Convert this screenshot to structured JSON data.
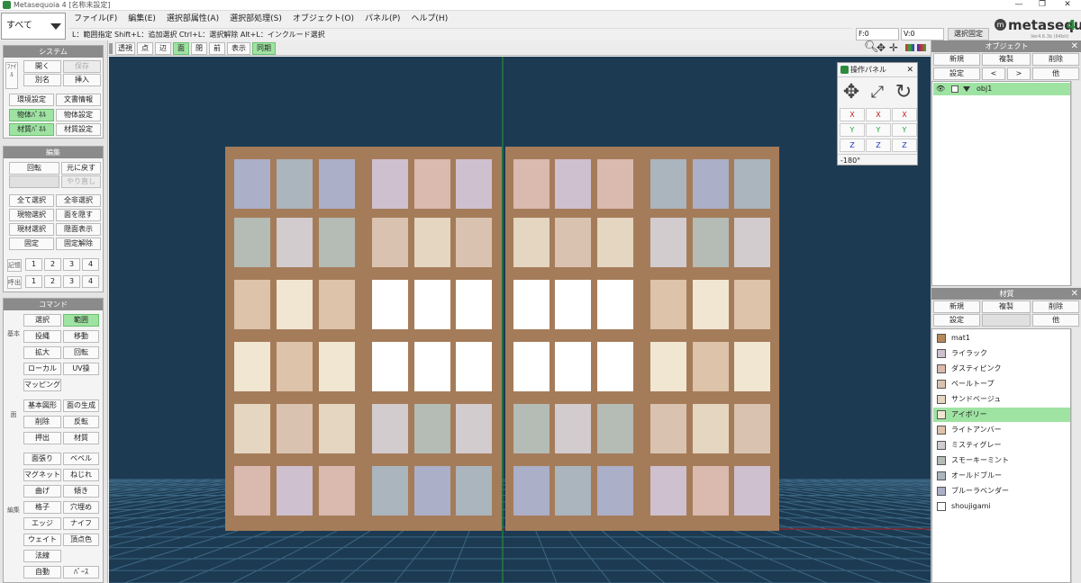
{
  "window": {
    "title": "Metasequoia 4 [名称未設定]",
    "controls": [
      "—",
      "❐",
      "✕"
    ]
  },
  "object_dropdown": {
    "value": "すべて"
  },
  "menu": [
    "ファイル(F)",
    "編集(E)",
    "選択部属性(A)",
    "選択部処理(S)",
    "オブジェクト(O)",
    "パネル(P)",
    "ヘルプ(H)"
  ],
  "hint": "L：範囲指定  Shift+L：追加選択  Ctrl+L：選択解除  Alt+L：インクルード選択",
  "status": {
    "f": "F:0",
    "v": "V:0",
    "lock": "選択固定"
  },
  "logo": {
    "text": "metasequoia",
    "num": "4",
    "version": "Ver4.6.3b (64bit)"
  },
  "system": {
    "title": "システム",
    "file_label": "ﾌｧｲﾙ",
    "open": "開く",
    "save": "保存",
    "save_as": "別名",
    "insert": "挿入",
    "env": "環境設定",
    "docinfo": "文書情報",
    "objpanel": "物体ﾊﾟﾈﾙ",
    "objset": "物体設定",
    "matpanel": "材質ﾊﾟﾈﾙ",
    "matset": "材質設定"
  },
  "edit": {
    "title": "編集",
    "rotate": "回転",
    "undo": "元に戻す",
    "redo": "やり直し",
    "selall": "全て選択",
    "deselall": "全非選択",
    "selobj": "現物選択",
    "hideface": "面を隠す",
    "selmat": "現材選択",
    "showhidden": "隠面表示",
    "fix": "固定",
    "unfix": "固定解除",
    "memory_label": "記憶",
    "recall_label": "呼出",
    "slots": [
      "1",
      "2",
      "3",
      "4"
    ]
  },
  "command": {
    "title": "コマンド",
    "group1_label": "基本",
    "group2_label": "面",
    "group3_label": "編集",
    "select": "選択",
    "range": "範囲",
    "lasso": "投縄",
    "move": "移動",
    "scale": "拡大",
    "rotate": "回転",
    "local": "ローカル",
    "uv": "UV操",
    "mapping": "マッピング",
    "primitive": "基本図形",
    "genface": "面の生成",
    "delete": "削除",
    "flip": "反転",
    "extrude": "押出",
    "material": "材質",
    "faceextend": "面張り",
    "bevel": "ベベル",
    "magnet": "マグネット",
    "twist": "ねじれ",
    "bend": "曲げ",
    "tilt": "傾き",
    "lattice": "格子",
    "hole": "穴埋め",
    "edge": "エッジ",
    "knife": "ナイフ",
    "weld": "ウェイト",
    "vcolor": "頂点色",
    "normal": "法線",
    "more1": "自動",
    "more2": "ﾊﾟｰｽ"
  },
  "view_toolbar": {
    "buttons": [
      "透視",
      "点",
      "辺",
      "面",
      "閉",
      "前",
      "表示",
      "同期"
    ],
    "active": [
      "面",
      "同期"
    ]
  },
  "op_panel": {
    "title": "操作パネル",
    "close": "✕",
    "icons": [
      "move-icon",
      "scale-icon",
      "rotate-icon"
    ],
    "axes": [
      [
        "X",
        "X",
        "X"
      ],
      [
        "Y",
        "Y",
        "Y"
      ],
      [
        "Z",
        "Z",
        "Z"
      ]
    ],
    "angle": "-180°"
  },
  "object_panel": {
    "title": "オブジェクト",
    "close": "✕",
    "new": "新規",
    "copy": "複製",
    "delete": "削除",
    "settings": "設定",
    "prev": "<",
    "next": ">",
    "other": "他",
    "objects": [
      {
        "name": "obj1"
      }
    ]
  },
  "material_panel": {
    "title": "材質",
    "close": "✕",
    "new": "新規",
    "copy": "複製",
    "delete": "削除",
    "settings": "設定",
    "other": "他",
    "materials": [
      {
        "name": "mat1",
        "color": "#b7885a"
      },
      {
        "name": "ライラック",
        "color": "#cfc0d0"
      },
      {
        "name": "ダスティピンク",
        "color": "#dab9ae"
      },
      {
        "name": "ペールトープ",
        "color": "#d9c3b0"
      },
      {
        "name": "サンドベージュ",
        "color": "#e4d6c0"
      },
      {
        "name": "アイボリー",
        "color": "#f0e6d2"
      },
      {
        "name": "ライトアンバー",
        "color": "#dcc3aa"
      },
      {
        "name": "ミスティグレー",
        "color": "#d2cccf"
      },
      {
        "name": "スモーキーミント",
        "color": "#b4bcb5"
      },
      {
        "name": "オールドブルー",
        "color": "#aab5be"
      },
      {
        "name": "ブルーラベンダー",
        "color": "#acafc8"
      },
      {
        "name": "shoujigami",
        "color": "#ffffff"
      }
    ],
    "selected": "アイボリー"
  },
  "model": {
    "frame_color": "#a57c5a",
    "rows": [
      [
        "#acafc8",
        "#aab5be",
        "#acafc8",
        "#cfc0d0",
        "#dab9ae",
        "#cfc0d0",
        "#dab9ae",
        "#cfc0d0",
        "#dab9ae",
        "#aab5be",
        "#acafc8",
        "#aab5be"
      ],
      [
        "#b4bcb5",
        "#d2cccf",
        "#b4bcb5",
        "#d9c3b0",
        "#e4d6c0",
        "#d9c3b0",
        "#e4d6c0",
        "#d9c3b0",
        "#e4d6c0",
        "#d2cccf",
        "#b4bcb5",
        "#d2cccf"
      ],
      [
        "#dcc3aa",
        "#f0e6d2",
        "#dcc3aa",
        "#ffffff",
        "#ffffff",
        "#ffffff",
        "#ffffff",
        "#ffffff",
        "#ffffff",
        "#dcc3aa",
        "#f0e6d2",
        "#dcc3aa"
      ],
      [
        "#f0e6d2",
        "#dcc3aa",
        "#f0e6d2",
        "#ffffff",
        "#ffffff",
        "#ffffff",
        "#ffffff",
        "#ffffff",
        "#ffffff",
        "#f0e6d2",
        "#dcc3aa",
        "#f0e6d2"
      ],
      [
        "#e4d6c0",
        "#d9c3b0",
        "#e4d6c0",
        "#d2cccf",
        "#b4bcb5",
        "#d2cccf",
        "#b4bcb5",
        "#d2cccf",
        "#b4bcb5",
        "#d9c3b0",
        "#e4d6c0",
        "#d9c3b0"
      ],
      [
        "#dab9ae",
        "#cfc0d0",
        "#dab9ae",
        "#aab5be",
        "#acafc8",
        "#aab5be",
        "#acafc8",
        "#aab5be",
        "#acafc8",
        "#cfc0d0",
        "#dab9ae",
        "#cfc0d0"
      ]
    ]
  },
  "colors": {
    "accent": "#9fe3a3",
    "viewport_bg": "#1c3b52",
    "axis_x": "#c02020",
    "axis_y": "#20a030",
    "axis_z": "#2030c0"
  }
}
